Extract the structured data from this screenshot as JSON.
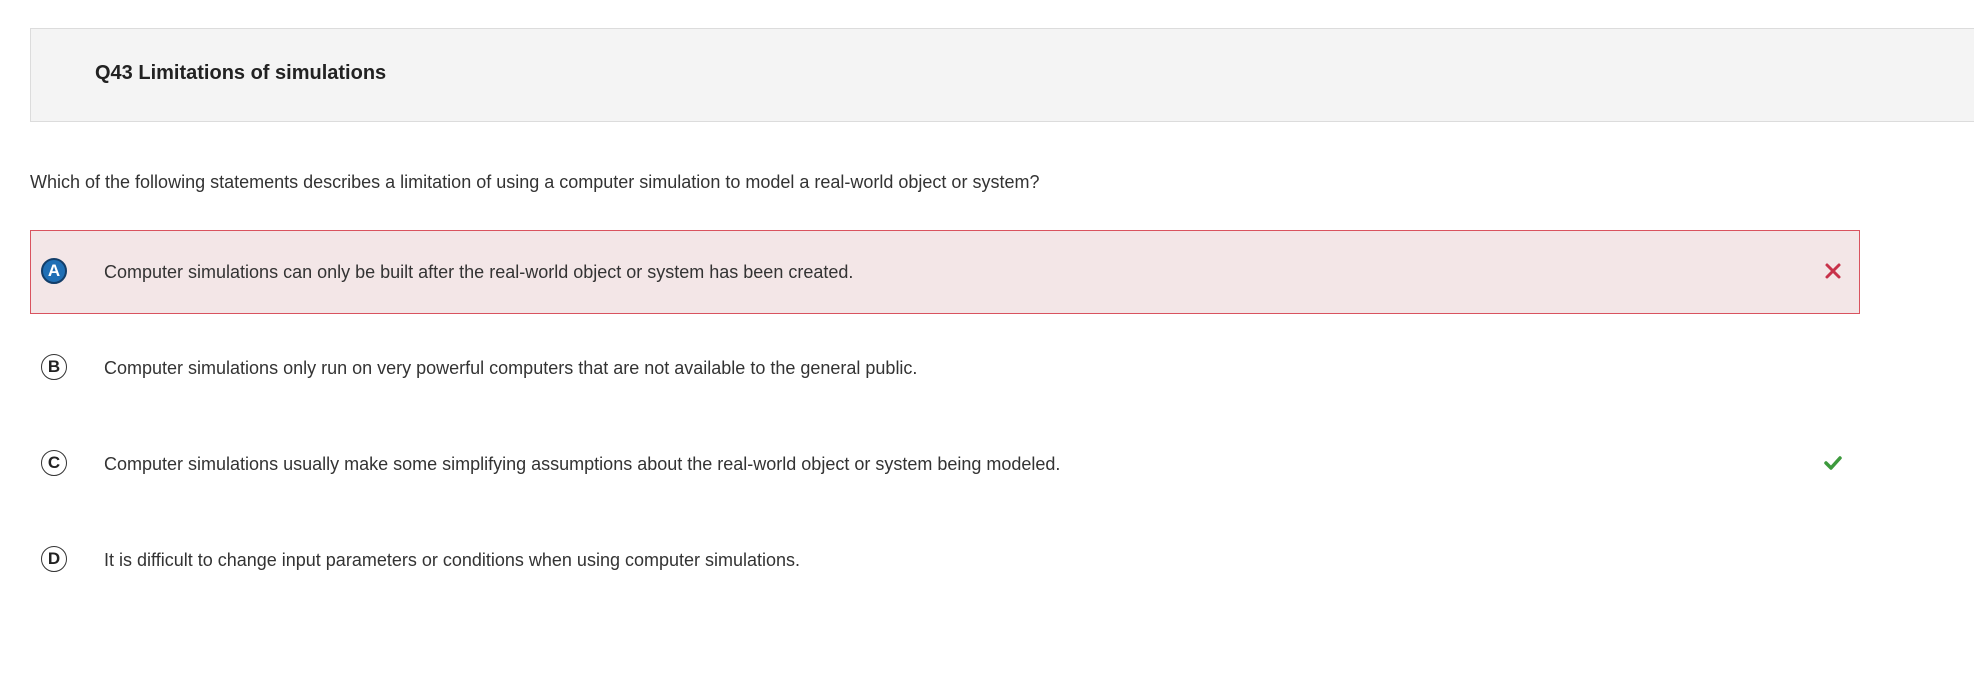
{
  "question": {
    "title": "Q43 Limitations of simulations",
    "prompt": "Which of the following statements describes a limitation of using a computer simulation to model a real-world object or system?"
  },
  "options": [
    {
      "letter": "A",
      "text": "Computer simulations can only be built after the real-world object or system has been created.",
      "selected": true,
      "status": "incorrect",
      "mark_icon": "x-icon"
    },
    {
      "letter": "B",
      "text": "Computer simulations only run on very powerful computers that are not available to the general public.",
      "selected": false,
      "status": "none"
    },
    {
      "letter": "C",
      "text": "Computer simulations usually make some simplifying assumptions about the real-world object or system being modeled.",
      "selected": false,
      "status": "correct",
      "mark_icon": "checkmark-icon"
    },
    {
      "letter": "D",
      "text": "It is difficult to change input parameters or conditions when using computer simulations.",
      "selected": false,
      "status": "none"
    }
  ],
  "colors": {
    "selected_letter_bg": "#1f6fb5",
    "incorrect_bg": "#f3e6e7",
    "incorrect_border": "#d9535f",
    "x_mark": "#c8324a",
    "check_mark": "#3d9a3d",
    "header_bg": "#f4f4f4"
  }
}
